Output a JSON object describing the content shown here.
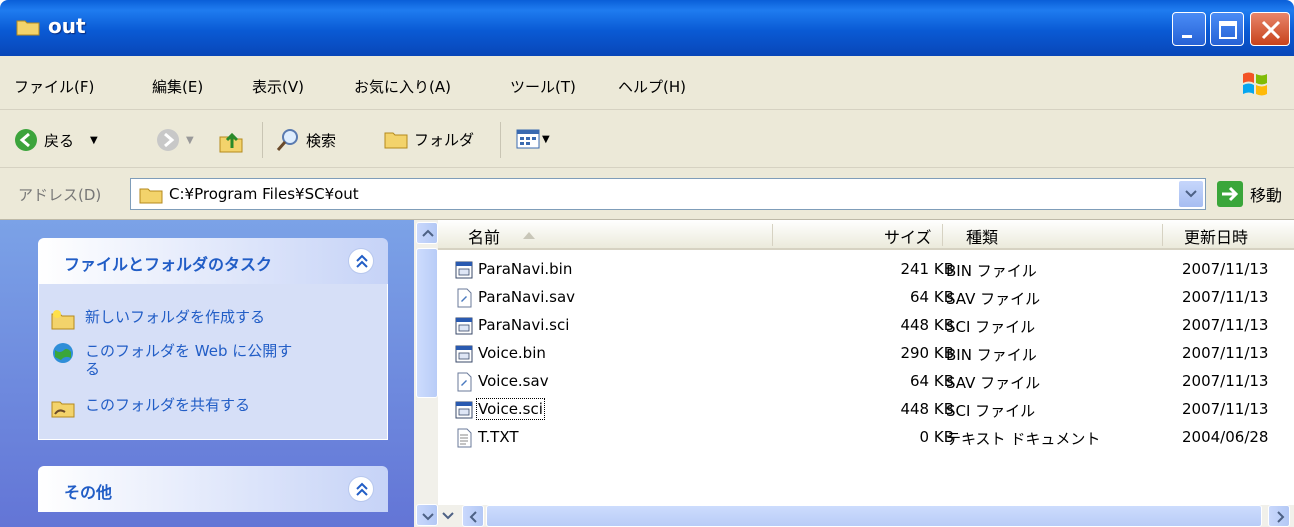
{
  "window": {
    "title": "out"
  },
  "menu": [
    "ファイル(F)",
    "編集(E)",
    "表示(V)",
    "お気に入り(A)",
    "ツール(T)",
    "ヘルプ(H)"
  ],
  "toolbar": {
    "back_label": "戻る",
    "search_label": "検索",
    "folders_label": "フォルダ"
  },
  "address": {
    "label": "アドレス(D)",
    "path": "C:¥Program Files¥SC¥out",
    "go_label": "移動"
  },
  "tasks_panel": {
    "title": "ファイルとフォルダのタスク",
    "items": [
      "新しいフォルダを作成する",
      "このフォルダを Web に公開する",
      "このフォルダを共有する"
    ]
  },
  "other_panel": {
    "title": "その他"
  },
  "columns": {
    "name": "名前",
    "size": "サイズ",
    "type": "種類",
    "modified": "更新日時"
  },
  "files": [
    {
      "name": "ParaNavi.bin",
      "size": "241 KB",
      "type": "BIN ファイル",
      "modified": "2007/11/13",
      "icon": "binary-file-icon"
    },
    {
      "name": "ParaNavi.sav",
      "size": "64 KB",
      "type": "SAV ファイル",
      "modified": "2007/11/13",
      "icon": "generic-file-icon"
    },
    {
      "name": "ParaNavi.sci",
      "size": "448 KB",
      "type": "SCI ファイル",
      "modified": "2007/11/13",
      "icon": "binary-file-icon"
    },
    {
      "name": "Voice.bin",
      "size": "290 KB",
      "type": "BIN ファイル",
      "modified": "2007/11/13",
      "icon": "binary-file-icon"
    },
    {
      "name": "Voice.sav",
      "size": "64 KB",
      "type": "SAV ファイル",
      "modified": "2007/11/13",
      "icon": "generic-file-icon"
    },
    {
      "name": "Voice.sci",
      "size": "448 KB",
      "type": "SCI ファイル",
      "modified": "2007/11/13",
      "icon": "binary-file-icon"
    },
    {
      "name": "T.TXT",
      "size": "0 KB",
      "type": "テキスト ドキュメント",
      "modified": "2004/06/28",
      "icon": "text-file-icon"
    }
  ],
  "colors": {
    "titlebar": "#0a5ad4",
    "link": "#215dc6",
    "chrome": "#ece9d8"
  }
}
